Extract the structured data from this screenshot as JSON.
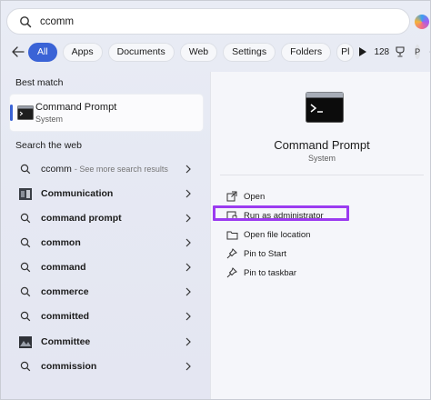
{
  "search": {
    "value": "ccomm"
  },
  "filters": {
    "chips": [
      "All",
      "Apps",
      "Documents",
      "Web",
      "Settings",
      "Folders",
      "Pl"
    ],
    "points": "128",
    "avatar": "P"
  },
  "left": {
    "best_match_title": "Best match",
    "best": {
      "name": "Command Prompt",
      "sub": "System"
    },
    "web_title": "Search the web",
    "results": [
      {
        "label": "ccomm",
        "hint": "- See more search results",
        "icon": "search-icon"
      },
      {
        "label": "Communication",
        "hint": "",
        "icon": "image-icon"
      },
      {
        "label": "command prompt",
        "hint": "",
        "icon": "search-icon"
      },
      {
        "label": "common",
        "hint": "",
        "icon": "search-icon"
      },
      {
        "label": "command",
        "hint": "",
        "icon": "search-icon"
      },
      {
        "label": "commerce",
        "hint": "",
        "icon": "search-icon"
      },
      {
        "label": "committed",
        "hint": "",
        "icon": "search-icon"
      },
      {
        "label": "Committee",
        "hint": "",
        "icon": "image-icon"
      },
      {
        "label": "commission",
        "hint": "",
        "icon": "search-icon"
      }
    ]
  },
  "panel": {
    "title": "Command Prompt",
    "sub": "System",
    "actions": [
      "Open",
      "Run as administrator",
      "Open file location",
      "Pin to Start",
      "Pin to taskbar"
    ]
  },
  "colors": {
    "accent": "#3a63d6",
    "highlight": "#9b3bf0"
  }
}
